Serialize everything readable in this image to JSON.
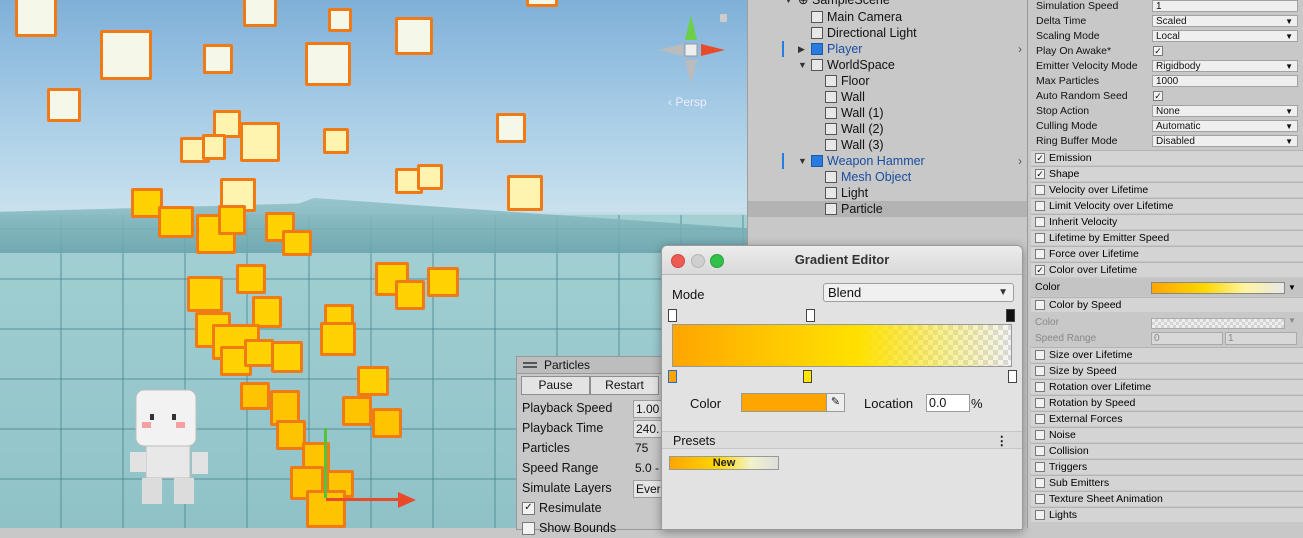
{
  "scene": {
    "persp_label": "‹ Persp",
    "colors": {
      "particle_border": "#f07b16",
      "particle_fill": "#ffd200"
    }
  },
  "particles_panel": {
    "title": "Particles",
    "pause_label": "Pause",
    "restart_label": "Restart",
    "rows": [
      {
        "label": "Playback Speed",
        "value": "1.00"
      },
      {
        "label": "Playback Time",
        "value": "240."
      },
      {
        "label": "Particles",
        "value": "75"
      },
      {
        "label": "Speed Range",
        "value": "5.0 -"
      },
      {
        "label": "Simulate Layers",
        "value": "Ever"
      }
    ],
    "resimulate_label": "Resimulate",
    "show_bounds_label": "Show Bounds"
  },
  "hierarchy": {
    "scene_name": "SampleScene*",
    "items": [
      {
        "label": "Main Camera"
      },
      {
        "label": "Directional Light"
      },
      {
        "label": "Player"
      },
      {
        "label": "WorldSpace"
      },
      {
        "label": "Floor"
      },
      {
        "label": "Wall"
      },
      {
        "label": "Wall (1)"
      },
      {
        "label": "Wall (2)"
      },
      {
        "label": "Wall (3)"
      },
      {
        "label": "Weapon Hammer"
      },
      {
        "label": "Mesh Object"
      },
      {
        "label": "Light"
      },
      {
        "label": "Particle"
      }
    ]
  },
  "gradient_editor": {
    "title": "Gradient Editor",
    "mode_label": "Mode",
    "mode_value": "Blend",
    "color_label": "Color",
    "color_value": "#ffa500",
    "location_label": "Location",
    "location_value": "0.0",
    "percent": "%",
    "presets_label": "Presets",
    "presets_more": "⋮",
    "preset_new": "New"
  },
  "inspector": {
    "rows": [
      {
        "label": "Simulation Speed",
        "value": "1",
        "type": "text"
      },
      {
        "label": "Delta Time",
        "value": "Scaled",
        "type": "dropdown"
      },
      {
        "label": "Scaling Mode",
        "value": "Local",
        "type": "dropdown"
      },
      {
        "label": "Play On Awake*",
        "value": "✓",
        "type": "check"
      },
      {
        "label": "Emitter Velocity Mode",
        "value": "Rigidbody",
        "type": "dropdown"
      },
      {
        "label": "Max Particles",
        "value": "1000",
        "type": "text"
      },
      {
        "label": "Auto Random Seed",
        "value": "✓",
        "type": "check"
      },
      {
        "label": "Stop Action",
        "value": "None",
        "type": "dropdown"
      },
      {
        "label": "Culling Mode",
        "value": "Automatic",
        "type": "dropdown"
      },
      {
        "label": "Ring Buffer Mode",
        "value": "Disabled",
        "type": "dropdown"
      }
    ],
    "modules_a": [
      {
        "label": "Emission",
        "checked": "✓"
      },
      {
        "label": "Shape",
        "checked": "✓"
      },
      {
        "label": "Velocity over Lifetime",
        "checked": ""
      },
      {
        "label": "Limit Velocity over Lifetime",
        "checked": ""
      },
      {
        "label": "Inherit Velocity",
        "checked": ""
      },
      {
        "label": "Lifetime by Emitter Speed",
        "checked": ""
      },
      {
        "label": "Force over Lifetime",
        "checked": ""
      },
      {
        "label": "Color over Lifetime",
        "checked": "✓"
      }
    ],
    "color_row_label": "Color",
    "color_by_speed_label": "Color by Speed",
    "cbs_color_label": "Color",
    "speed_range_label": "Speed Range",
    "speed_range_min": "0",
    "speed_range_max": "1",
    "modules_b": [
      {
        "label": "Size over Lifetime",
        "checked": ""
      },
      {
        "label": "Size by Speed",
        "checked": ""
      },
      {
        "label": "Rotation over Lifetime",
        "checked": ""
      },
      {
        "label": "Rotation by Speed",
        "checked": ""
      },
      {
        "label": "External Forces",
        "checked": ""
      },
      {
        "label": "Noise",
        "checked": ""
      },
      {
        "label": "Collision",
        "checked": ""
      },
      {
        "label": "Triggers",
        "checked": ""
      },
      {
        "label": "Sub Emitters",
        "checked": ""
      },
      {
        "label": "Texture Sheet Animation",
        "checked": ""
      },
      {
        "label": "Lights",
        "checked": ""
      }
    ]
  }
}
